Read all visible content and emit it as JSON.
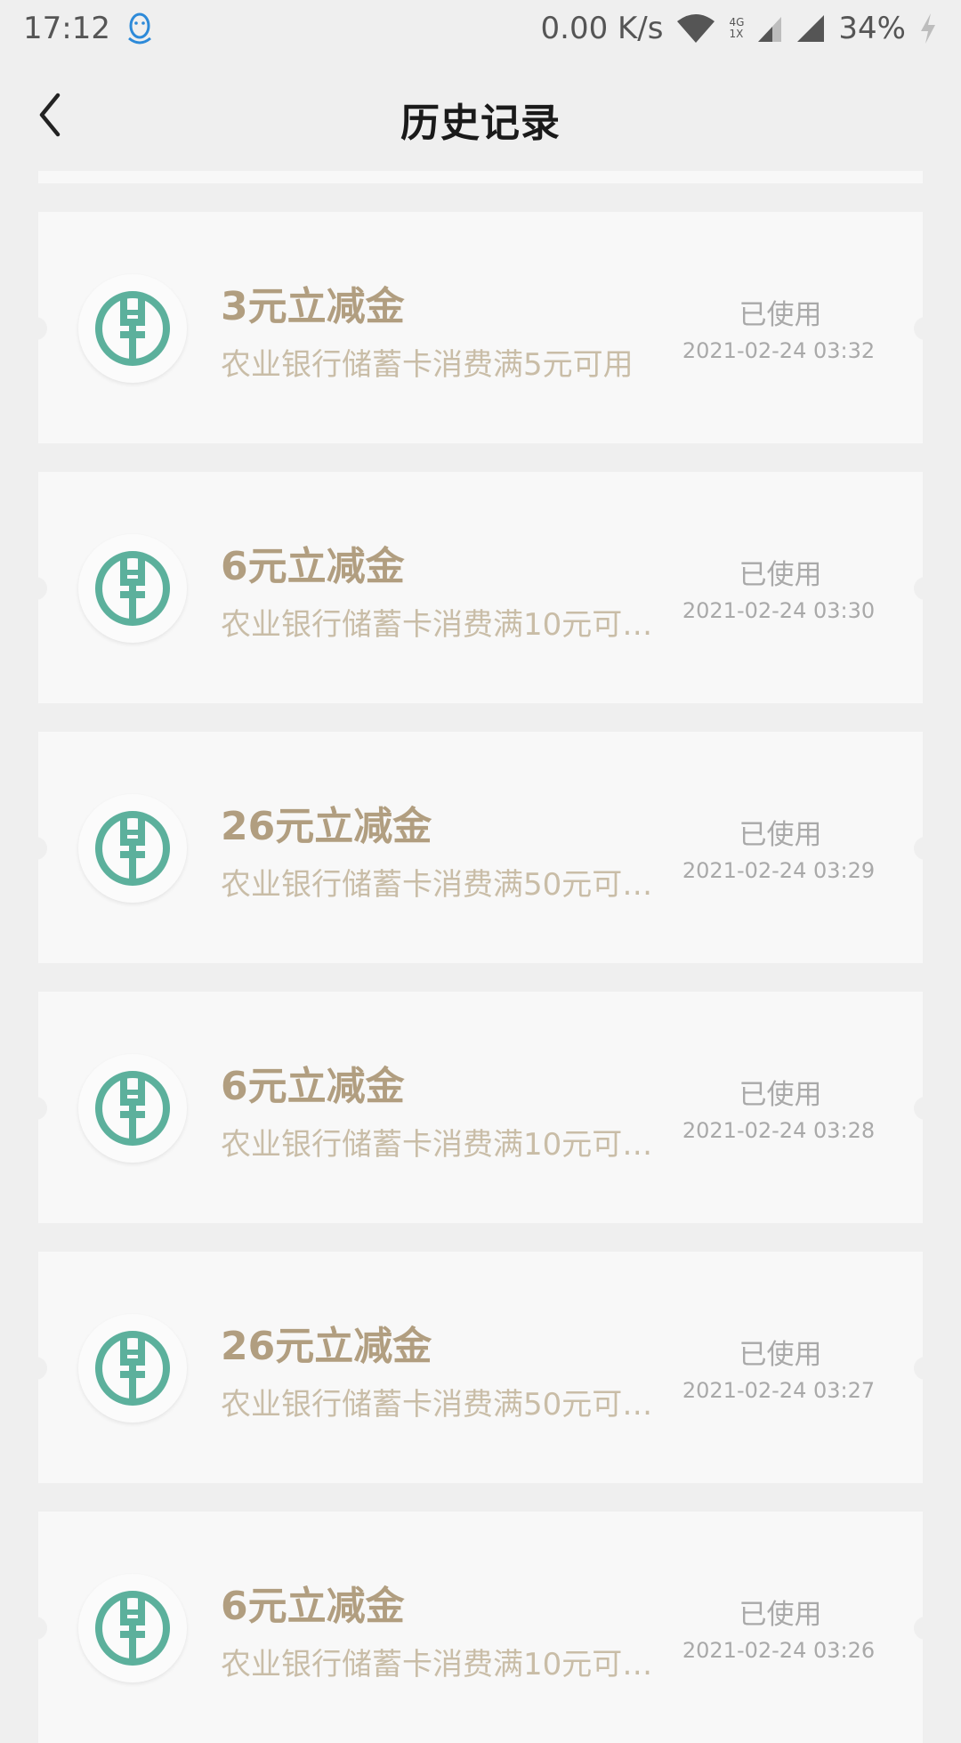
{
  "status_bar": {
    "time": "17:12",
    "net_speed": "0.00 K/s",
    "network_4g": "4G",
    "network_1x": "1X",
    "battery": "34%"
  },
  "nav": {
    "title": "历史记录"
  },
  "coupons": [
    {
      "title": "3元立减金",
      "desc": "农业银行储蓄卡消费满5元可用",
      "status": "已使用",
      "time": "2021-02-24 03:32"
    },
    {
      "title": "6元立减金",
      "desc": "农业银行储蓄卡消费满10元可…",
      "status": "已使用",
      "time": "2021-02-24 03:30"
    },
    {
      "title": "26元立减金",
      "desc": "农业银行储蓄卡消费满50元可…",
      "status": "已使用",
      "time": "2021-02-24 03:29"
    },
    {
      "title": "6元立减金",
      "desc": "农业银行储蓄卡消费满10元可…",
      "status": "已使用",
      "time": "2021-02-24 03:28"
    },
    {
      "title": "26元立减金",
      "desc": "农业银行储蓄卡消费满50元可…",
      "status": "已使用",
      "time": "2021-02-24 03:27"
    },
    {
      "title": "6元立减金",
      "desc": "农业银行储蓄卡消费满10元可…",
      "status": "已使用",
      "time": "2021-02-24 03:26"
    }
  ],
  "colors": {
    "title": "#b19e80",
    "desc": "#c9bda7",
    "logo_green": "#5cb09c",
    "background": "#efefef",
    "card": "#f8f8f8"
  },
  "icons": {
    "back": "chevron-left-icon",
    "qq": "qq-penguin-icon",
    "wifi": "wifi-icon",
    "signal": "cellular-signal-icon",
    "charging": "charging-bolt-icon",
    "bank_logo": "agricultural-bank-logo-icon"
  }
}
